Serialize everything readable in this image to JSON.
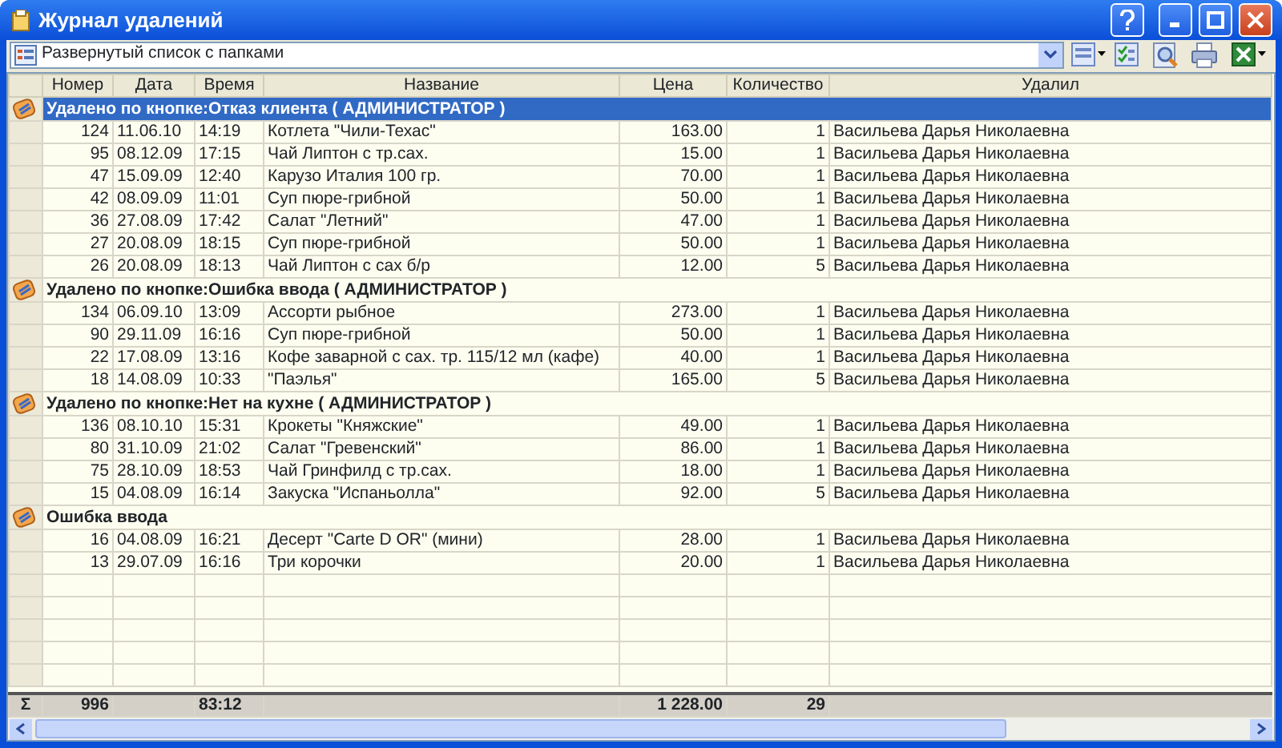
{
  "window": {
    "title": "Журнал удалений"
  },
  "view_select": {
    "value": "Развернутый список с папками"
  },
  "table": {
    "columns": [
      "Номер",
      "Дата",
      "Время",
      "Название",
      "Цена",
      "Количество",
      "Удалил"
    ],
    "groups": [
      {
        "title": "Удалено по кнопке:Отказ клиента ( АДМИНИСТРАТОР )",
        "selected": true,
        "rows": [
          [
            "124",
            "11.06.10",
            "14:19",
            "Котлета \"Чили-Техас\"",
            "163.00",
            "1",
            "Васильева Дарья Николаевна"
          ],
          [
            "95",
            "08.12.09",
            "17:15",
            "Чай Липтон с тр.сах.",
            "15.00",
            "1",
            "Васильева Дарья Николаевна"
          ],
          [
            "47",
            "15.09.09",
            "12:40",
            "Карузо Италия 100 гр.",
            "70.00",
            "1",
            "Васильева Дарья Николаевна"
          ],
          [
            "42",
            "08.09.09",
            "11:01",
            "Суп пюре-грибной",
            "50.00",
            "1",
            "Васильева Дарья Николаевна"
          ],
          [
            "36",
            "27.08.09",
            "17:42",
            "Салат \"Летний\"",
            "47.00",
            "1",
            "Васильева Дарья Николаевна"
          ],
          [
            "27",
            "20.08.09",
            "18:15",
            "Суп пюре-грибной",
            "50.00",
            "1",
            "Васильева Дарья Николаевна"
          ],
          [
            "26",
            "20.08.09",
            "18:13",
            "Чай Липтон с сах б/р",
            "12.00",
            "5",
            "Васильева Дарья Николаевна"
          ]
        ]
      },
      {
        "title": "Удалено по кнопке:Ошибка ввода ( АДМИНИСТРАТОР )",
        "selected": false,
        "rows": [
          [
            "134",
            "06.09.10",
            "13:09",
            "Ассорти рыбное",
            "273.00",
            "1",
            "Васильева Дарья Николаевна"
          ],
          [
            "90",
            "29.11.09",
            "16:16",
            "Суп пюре-грибной",
            "50.00",
            "1",
            "Васильева Дарья Николаевна"
          ],
          [
            "22",
            "17.08.09",
            "13:16",
            "Кофе заварной с сах. тр. 115/12 мл (кафе)",
            "40.00",
            "1",
            "Васильева Дарья Николаевна"
          ],
          [
            "18",
            "14.08.09",
            "10:33",
            "\"Паэлья\"",
            "165.00",
            "5",
            "Васильева Дарья Николаевна"
          ]
        ]
      },
      {
        "title": "Удалено по кнопке:Нет на кухне ( АДМИНИСТРАТОР )",
        "selected": false,
        "rows": [
          [
            "136",
            "08.10.10",
            "15:31",
            "Крокеты \"Княжские\"",
            "49.00",
            "1",
            "Васильева Дарья Николаевна"
          ],
          [
            "80",
            "31.10.09",
            "21:02",
            "Салат \"Гревенский\"",
            "86.00",
            "1",
            "Васильева Дарья Николаевна"
          ],
          [
            "75",
            "28.10.09",
            "18:53",
            "Чай Гринфилд с тр.сах.",
            "18.00",
            "1",
            "Васильева Дарья Николаевна"
          ],
          [
            "15",
            "04.08.09",
            "16:14",
            "Закуска \"Испаньолла\"",
            "92.00",
            "5",
            "Васильева Дарья Николаевна"
          ]
        ]
      },
      {
        "title": "Ошибка ввода",
        "selected": false,
        "rows": [
          [
            "16",
            "04.08.09",
            "16:21",
            "Десерт \"Carte D OR\" (мини)",
            "28.00",
            "1",
            "Васильева Дарья Николаевна"
          ],
          [
            "13",
            "29.07.09",
            "16:16",
            "Три корочки",
            "20.00",
            "1",
            "Васильева Дарья Николаевна"
          ]
        ]
      }
    ],
    "totals": {
      "sigma": "Σ",
      "number": "996",
      "time": "83:12",
      "price": "1 228.00",
      "quantity": "29"
    }
  }
}
